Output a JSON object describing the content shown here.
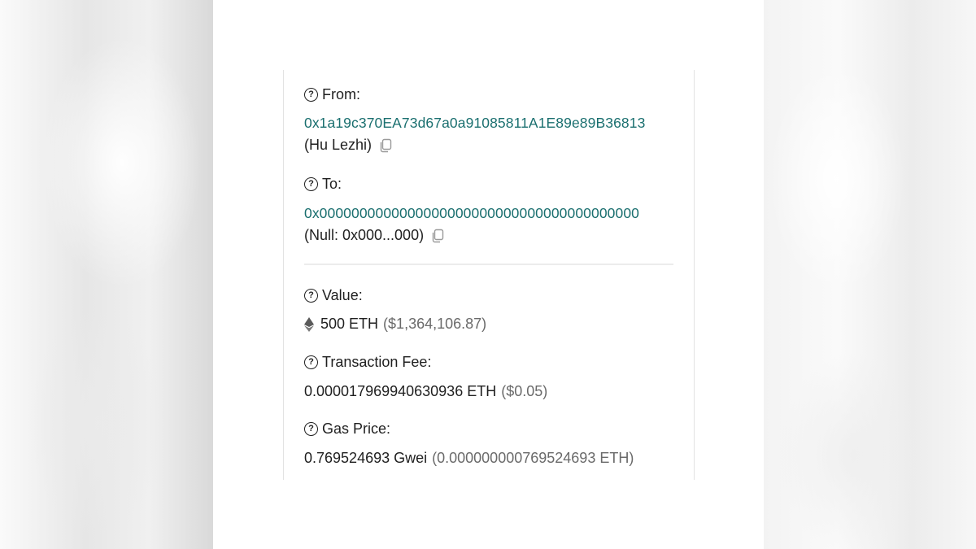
{
  "from": {
    "label": "From:",
    "address": "0x1a19c370EA73d67a0a91085811A1E89e89B36813",
    "name": "(Hu Lezhi)"
  },
  "to": {
    "label": "To:",
    "address": "0x0000000000000000000000000000000000000000",
    "name": "(Null: 0x000...000)"
  },
  "value": {
    "label": "Value:",
    "amount": "500 ETH",
    "usd": "($1,364,106.87)"
  },
  "fee": {
    "label": "Transaction Fee:",
    "amount": "0.000017969940630936 ETH",
    "usd": "($0.05)"
  },
  "gas": {
    "label": "Gas Price:",
    "amount": "0.769524693 Gwei",
    "eth": "(0.000000000769524693 ETH)"
  },
  "icons": {
    "help": "question-circle-icon",
    "copy": "copy-icon",
    "eth": "ethereum-icon"
  },
  "colors": {
    "link": "#1a6f6f",
    "text": "#1f1f1f",
    "muted": "#6a6a6a"
  }
}
